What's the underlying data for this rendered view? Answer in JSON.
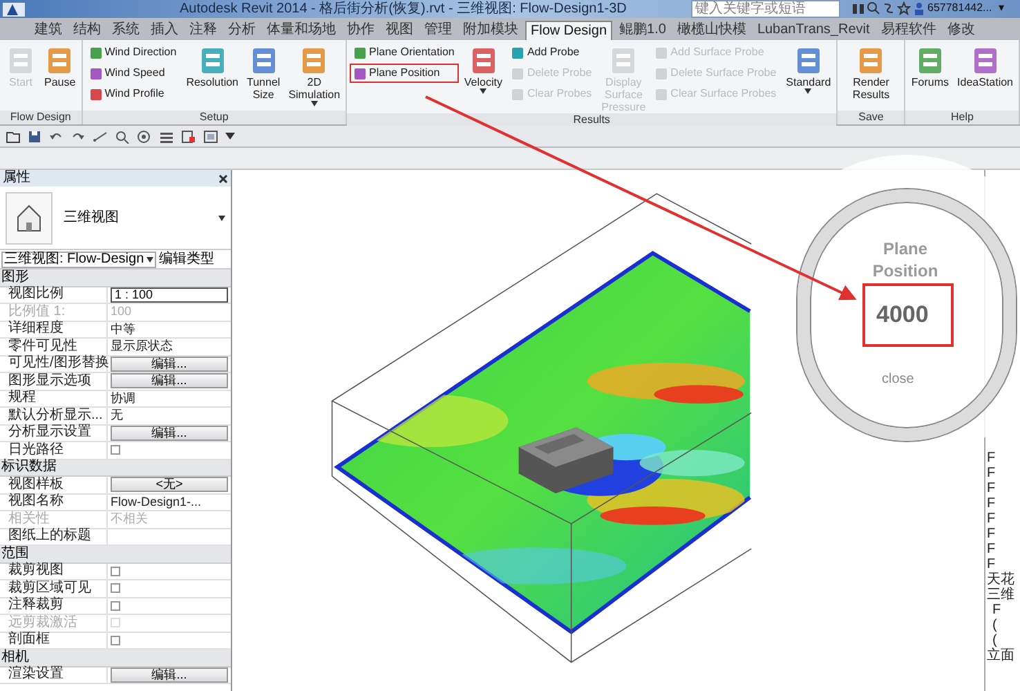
{
  "window": {
    "title": "Autodesk Revit 2014 -    格后街分析(恢复).rvt - 三维视图: Flow-Design1-3D",
    "search": {
      "placeholder": "键入关键字或短语"
    },
    "user": "657781442...",
    "caret": "▾"
  },
  "tabs": [
    {
      "label": "建筑",
      "selected": false
    },
    {
      "label": "结构",
      "selected": false
    },
    {
      "label": "系统",
      "selected": false
    },
    {
      "label": "插入",
      "selected": false
    },
    {
      "label": "注释",
      "selected": false
    },
    {
      "label": "分析",
      "selected": false
    },
    {
      "label": "体量和场地",
      "selected": false
    },
    {
      "label": "协作",
      "selected": false
    },
    {
      "label": "视图",
      "selected": false
    },
    {
      "label": "管理",
      "selected": false
    },
    {
      "label": "附加模块",
      "selected": false
    },
    {
      "label": "Flow Design",
      "selected": true
    },
    {
      "label": "鲲鹏1.0",
      "selected": false
    },
    {
      "label": "橄榄山快模",
      "selected": false
    },
    {
      "label": "LubanTrans_Revit",
      "selected": false
    },
    {
      "label": "易程软件",
      "selected": false
    },
    {
      "label": "修改",
      "selected": false
    }
  ],
  "ribbon": [
    {
      "label": "Flow Design",
      "items": [
        {
          "kind": "large",
          "label": "Start",
          "disabled": true,
          "highlighted": false
        },
        {
          "kind": "large",
          "label": "Pause",
          "disabled": false,
          "highlighted": false
        }
      ]
    },
    {
      "label": "Setup",
      "items": [
        {
          "kind": "stack",
          "items": [
            {
              "label": "Wind Direction",
              "disabled": false,
              "highlighted": false
            },
            {
              "label": "Wind Speed",
              "disabled": false,
              "highlighted": false
            },
            {
              "label": "Wind Profile",
              "disabled": false,
              "highlighted": false
            }
          ]
        },
        {
          "kind": "large",
          "label": "Resolution",
          "disabled": false,
          "highlighted": false
        },
        {
          "kind": "large",
          "label": "Tunnel Size",
          "disabled": false,
          "highlighted": false
        },
        {
          "kind": "large",
          "label": "2D Simulation",
          "disabled": false,
          "highlighted": false,
          "dropdown": true
        }
      ]
    },
    {
      "label": "Results",
      "items": [
        {
          "kind": "stack",
          "items": [
            {
              "label": "Plane Orientation",
              "disabled": false,
              "highlighted": false
            },
            {
              "label": "Plane Position",
              "disabled": false,
              "highlighted": true
            }
          ]
        },
        {
          "kind": "large",
          "label": "Velocity",
          "disabled": false,
          "highlighted": false,
          "dropdown": true
        },
        {
          "kind": "stack",
          "items": [
            {
              "label": "Add Probe",
              "disabled": false,
              "highlighted": false
            },
            {
              "label": "Delete Probe",
              "disabled": true,
              "highlighted": false
            },
            {
              "label": "Clear Probes",
              "disabled": true,
              "highlighted": false
            }
          ]
        },
        {
          "kind": "large",
          "label": "Display Surface Pressure",
          "disabled": true,
          "highlighted": false
        },
        {
          "kind": "stack",
          "items": [
            {
              "label": "Add Surface Probe",
              "disabled": true,
              "highlighted": false
            },
            {
              "label": "Delete Surface Probe",
              "disabled": true,
              "highlighted": false
            },
            {
              "label": "Clear Surface Probes",
              "disabled": true,
              "highlighted": false
            }
          ]
        },
        {
          "kind": "large",
          "label": "Standard",
          "disabled": false,
          "highlighted": false,
          "dropdown": true
        }
      ]
    },
    {
      "label": "Save",
      "items": [
        {
          "kind": "large",
          "label": "Render Results",
          "disabled": false,
          "highlighted": false
        }
      ]
    },
    {
      "label": "Help",
      "items": [
        {
          "kind": "large",
          "label": "Forums",
          "disabled": false,
          "highlighted": false
        },
        {
          "kind": "large",
          "label": "IdeaStation",
          "disabled": false,
          "highlighted": false
        }
      ]
    }
  ],
  "properties": {
    "title": "属性",
    "type_name": "三维视图",
    "selector": "三维视图: Flow-Design",
    "edit_type": "编辑类型",
    "sections": [
      {
        "title": "图形",
        "rows": [
          {
            "label": "视图比例",
            "kind": "input",
            "value": "1 : 100",
            "disabled": false
          },
          {
            "label": "比例值 1:",
            "kind": "text",
            "value": "100",
            "disabled": true
          },
          {
            "label": "详细程度",
            "kind": "text",
            "value": "中等",
            "disabled": false
          },
          {
            "label": "零件可见性",
            "kind": "text",
            "value": "显示原状态",
            "disabled": false
          },
          {
            "label": "可见性/图形替换",
            "kind": "button",
            "value": "编辑...",
            "disabled": false
          },
          {
            "label": "图形显示选项",
            "kind": "button",
            "value": "编辑...",
            "disabled": false
          },
          {
            "label": "规程",
            "kind": "text",
            "value": "协调",
            "disabled": false
          },
          {
            "label": "默认分析显示...",
            "kind": "text",
            "value": "无",
            "disabled": false
          },
          {
            "label": "分析显示设置",
            "kind": "button",
            "value": "编辑...",
            "disabled": false
          },
          {
            "label": "日光路径",
            "kind": "checkbox",
            "checked": false,
            "disabled": false
          }
        ]
      },
      {
        "title": "标识数据",
        "rows": [
          {
            "label": "视图样板",
            "kind": "button",
            "value": "<无>",
            "disabled": false
          },
          {
            "label": "视图名称",
            "kind": "text",
            "value": "Flow-Design1-...",
            "disabled": false
          },
          {
            "label": "相关性",
            "kind": "text",
            "value": "不相关",
            "disabled": true
          },
          {
            "label": "图纸上的标题",
            "kind": "text",
            "disabled": false
          }
        ]
      },
      {
        "title": "范围",
        "rows": [
          {
            "label": "裁剪视图",
            "kind": "checkbox",
            "checked": false,
            "disabled": false
          },
          {
            "label": "裁剪区域可见",
            "kind": "checkbox",
            "checked": false,
            "disabled": false
          },
          {
            "label": "注释裁剪",
            "kind": "checkbox",
            "checked": false,
            "disabled": false
          },
          {
            "label": "远剪裁激活",
            "kind": "checkbox",
            "checked": false,
            "disabled": true
          },
          {
            "label": "剖面框",
            "kind": "checkbox",
            "checked": false,
            "disabled": false
          }
        ]
      },
      {
        "title": "相机",
        "rows": [
          {
            "label": "渲染设置",
            "kind": "button",
            "value": "编辑...",
            "disabled": false
          }
        ]
      }
    ]
  },
  "plane_dialog": {
    "title": "Plane Position",
    "value": "4000",
    "close": "close"
  },
  "browser": {
    "items": [
      {
        "label": "F"
      },
      {
        "label": "F"
      },
      {
        "label": "F"
      },
      {
        "label": "F"
      },
      {
        "label": "F"
      },
      {
        "label": "F"
      },
      {
        "label": "F"
      },
      {
        "label": "F"
      },
      {
        "label": "天花"
      },
      {
        "label": "三维",
        "children": [
          {
            "label": "F"
          },
          {
            "label": "("
          },
          {
            "label": "("
          }
        ]
      },
      {
        "label": "立面"
      }
    ]
  }
}
